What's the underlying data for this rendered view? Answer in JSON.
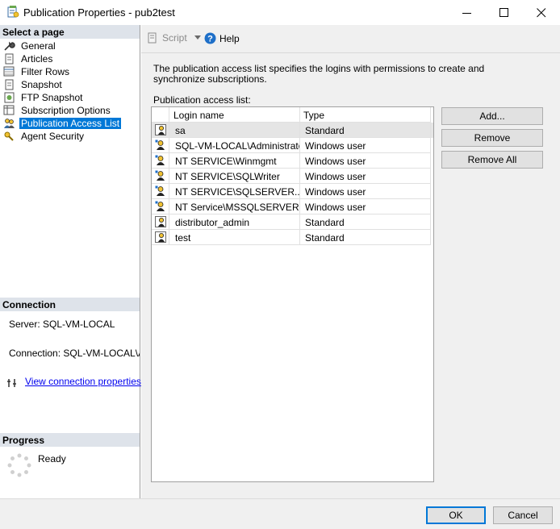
{
  "window": {
    "title": "Publication Properties - pub2test"
  },
  "left_pane": {
    "select_page_header": "Select a page",
    "pages": [
      {
        "label": "General",
        "icon": "wrench-icon"
      },
      {
        "label": "Articles",
        "icon": "page-icon"
      },
      {
        "label": "Filter Rows",
        "icon": "filter-icon"
      },
      {
        "label": "Snapshot",
        "icon": "page-icon"
      },
      {
        "label": "FTP Snapshot",
        "icon": "ftp-icon"
      },
      {
        "label": "Subscription Options",
        "icon": "grid-icon"
      },
      {
        "label": "Publication Access List",
        "icon": "users-icon",
        "selected": true
      },
      {
        "label": "Agent Security",
        "icon": "key-icon"
      }
    ],
    "connection_header": "Connection",
    "server_text": "Server: SQL-VM-LOCAL",
    "connection_text": "Connection: SQL-VM-LOCAL\\Administrator",
    "view_connection_link": "View connection properties",
    "progress_header": "Progress",
    "progress_status": "Ready"
  },
  "toolbar": {
    "script_label": "Script",
    "help_label": "Help"
  },
  "content": {
    "description": "The publication access list specifies the logins with permissions to create and synchronize subscriptions.",
    "list_label": "Publication access list:",
    "columns": [
      "Login name",
      "Type"
    ],
    "rows": [
      {
        "name": "sa",
        "type": "Standard",
        "kind": "standard"
      },
      {
        "name": "SQL-VM-LOCAL\\Administrator",
        "type": "Windows user",
        "kind": "windows"
      },
      {
        "name": "NT SERVICE\\Winmgmt",
        "type": "Windows user",
        "kind": "windows"
      },
      {
        "name": "NT SERVICE\\SQLWriter",
        "type": "Windows user",
        "kind": "windows"
      },
      {
        "name": "NT SERVICE\\SQLSERVER...",
        "type": "Windows user",
        "kind": "windows"
      },
      {
        "name": "NT Service\\MSSQLSERVER",
        "type": "Windows user",
        "kind": "windows"
      },
      {
        "name": "distributor_admin",
        "type": "Standard",
        "kind": "standard"
      },
      {
        "name": "test",
        "type": "Standard",
        "kind": "standard"
      }
    ],
    "add_label": "Add...",
    "remove_label": "Remove",
    "remove_all_label": "Remove All"
  },
  "footer": {
    "ok_label": "OK",
    "cancel_label": "Cancel"
  }
}
